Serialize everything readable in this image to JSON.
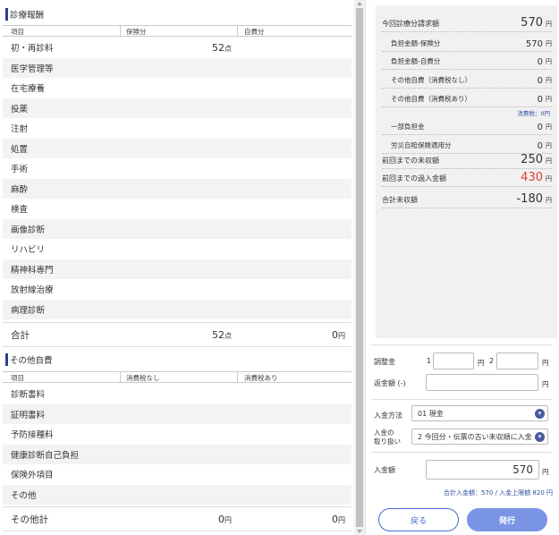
{
  "medical_fees": {
    "title": "診療報酬",
    "col_item": "項目",
    "col_insurance": "保険分",
    "col_self": "自費分",
    "items": [
      {
        "label": "初・再診料",
        "value": "52",
        "unit": "点"
      },
      {
        "label": "医学管理等",
        "value": "",
        "unit": ""
      },
      {
        "label": "在宅療養",
        "value": "",
        "unit": ""
      },
      {
        "label": "投薬",
        "value": "",
        "unit": ""
      },
      {
        "label": "注射",
        "value": "",
        "unit": ""
      },
      {
        "label": "処置",
        "value": "",
        "unit": ""
      },
      {
        "label": "手術",
        "value": "",
        "unit": ""
      },
      {
        "label": "麻酔",
        "value": "",
        "unit": ""
      },
      {
        "label": "検査",
        "value": "",
        "unit": ""
      },
      {
        "label": "画像診断",
        "value": "",
        "unit": ""
      },
      {
        "label": "リハビリ",
        "value": "",
        "unit": ""
      },
      {
        "label": "精神科専門",
        "value": "",
        "unit": ""
      },
      {
        "label": "放射線治療",
        "value": "",
        "unit": ""
      },
      {
        "label": "病理診断",
        "value": "",
        "unit": ""
      }
    ],
    "total_label": "合計",
    "total_insurance": "52",
    "total_insurance_unit": "点",
    "total_self": "0",
    "total_self_unit": "円"
  },
  "other_fees": {
    "title": "その他自費",
    "col_item": "項目",
    "col_no_tax": "消費税なし",
    "col_with_tax": "消費税あり",
    "items": [
      {
        "label": "診断書料"
      },
      {
        "label": "証明書料"
      },
      {
        "label": "予防接種料"
      },
      {
        "label": "健康診断自己負担"
      },
      {
        "label": "保険外項目"
      },
      {
        "label": "その他"
      }
    ],
    "total_label": "その他計",
    "total_no_tax": "0",
    "total_no_tax_unit": "円",
    "total_with_tax": "0",
    "total_with_tax_unit": "円"
  },
  "summary": {
    "rows": [
      {
        "label": "今回診療分請求額",
        "value": "570",
        "unit": "円"
      },
      {
        "label": "負担金額-保険分",
        "value": "570",
        "unit": "円"
      },
      {
        "label": "負担金額-自費分",
        "value": "0",
        "unit": "円"
      },
      {
        "label": "その他自費（消費税なし）",
        "value": "0",
        "unit": "円"
      },
      {
        "label": "その他自費（消費税あり）",
        "value": "0",
        "unit": "円"
      },
      {
        "label": "一部負担金",
        "value": "0",
        "unit": "円"
      },
      {
        "label": "労災自賠保険適用分",
        "value": "0",
        "unit": "円"
      },
      {
        "label": "前回までの未収額",
        "value": "250",
        "unit": "円"
      },
      {
        "label": "前回までの過入金額",
        "value": "430",
        "unit": "円"
      },
      {
        "label": "合計未収額",
        "value": "-180",
        "unit": "円"
      }
    ],
    "tax_note": "消費税：0円",
    "overpaid_color": "#e03c31"
  },
  "adjust": {
    "label": "調整金",
    "field1_label": "1",
    "field1_unit": "円",
    "field2_label": "2",
    "field2_unit": "円"
  },
  "refund": {
    "label": "返金額 (-)",
    "unit": "円"
  },
  "payment_method": {
    "label": "入金方法",
    "selected": "01 現金"
  },
  "payment_handling": {
    "label_line1": "入金の",
    "label_line2": "取り扱い",
    "selected": "2 今回分・伝票の古い未収順に入金"
  },
  "payment_amount": {
    "label": "入金額",
    "value": "570",
    "unit": "円"
  },
  "payment_note": "合計入金額：570 / 入金上限額 820 円",
  "buttons": {
    "back": "戻る",
    "issue": "発行"
  }
}
